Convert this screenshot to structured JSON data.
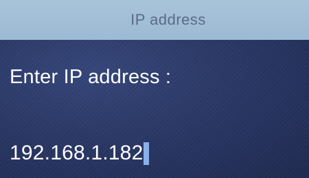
{
  "header": {
    "title": "IP address"
  },
  "main": {
    "prompt": "Enter IP address :",
    "ip_value": "192.168.1.182"
  },
  "colors": {
    "title_bar": "#a8c3da",
    "background": "#2a3866",
    "text": "#ffffff",
    "cursor": "#8ab0e8"
  }
}
